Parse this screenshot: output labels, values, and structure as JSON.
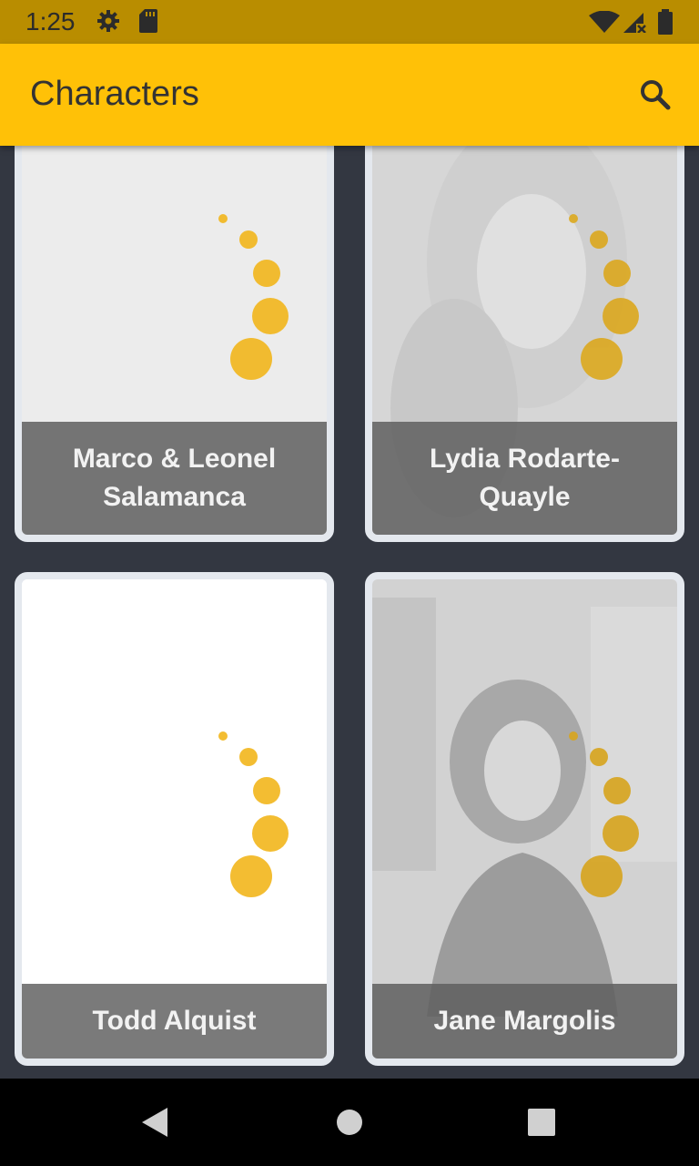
{
  "status_bar": {
    "time": "1:25",
    "icons": [
      "gear-icon",
      "sd-card-icon",
      "wifi-icon",
      "signal-icon",
      "battery-icon"
    ]
  },
  "app_bar": {
    "title": "Characters",
    "search_icon": "search-icon"
  },
  "colors": {
    "status_bar": "#b98d00",
    "app_bar": "#ffc107",
    "background": "#333741",
    "card_border": "#e4e8ee",
    "label_bg": "#5f5f5f",
    "loader_dots": "#f2b61c"
  },
  "characters": [
    {
      "name": "Marco & Leonel Salamanca",
      "image_state": "loading"
    },
    {
      "name": "Lydia Rodarte-Quayle",
      "image_state": "loading-over-photo"
    },
    {
      "name": "Todd Alquist",
      "image_state": "loading"
    },
    {
      "name": "Jane Margolis",
      "image_state": "loading-over-photo"
    }
  ],
  "nav_bar": {
    "icons": [
      "back-icon",
      "home-icon",
      "recents-icon"
    ]
  }
}
